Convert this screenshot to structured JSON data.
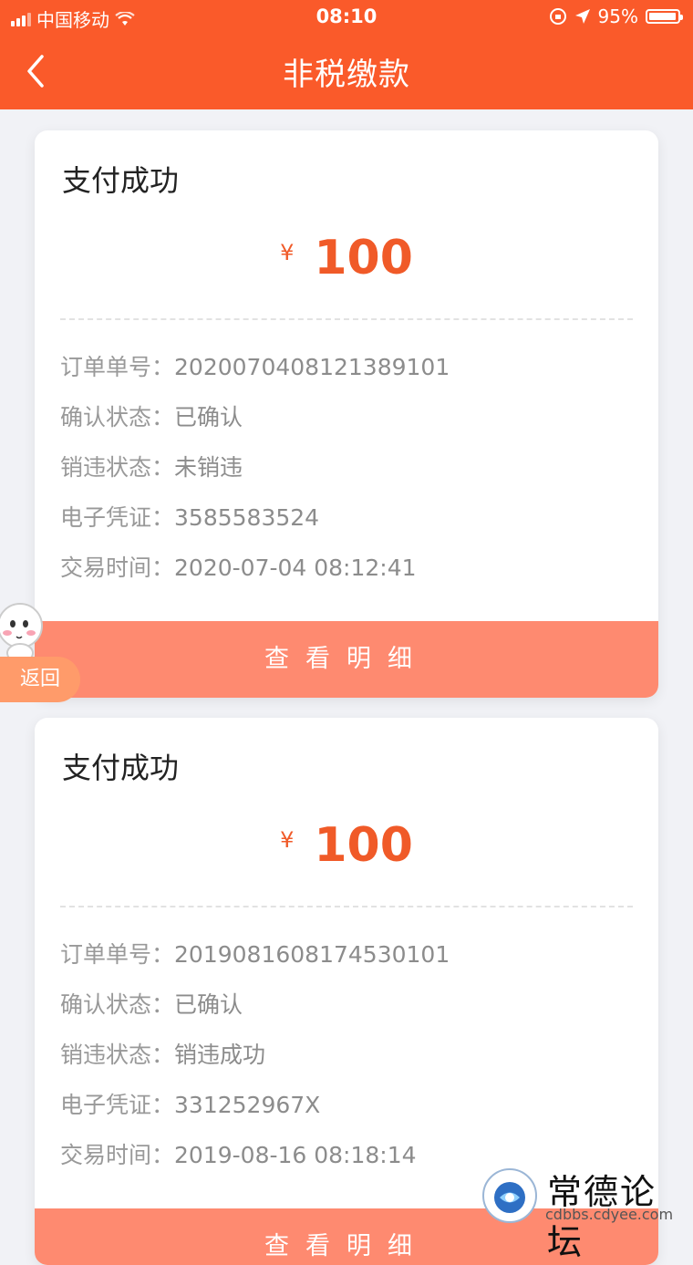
{
  "status_bar": {
    "carrier": "中国移动",
    "time": "08:10",
    "battery": "95%"
  },
  "header": {
    "title": "非税缴款"
  },
  "cards": [
    {
      "status": "支付成功",
      "currency": "¥",
      "amount": "100",
      "fields": [
        {
          "label": "订单单号：",
          "value": "2020070408121389101"
        },
        {
          "label": "确认状态：",
          "value": "已确认"
        },
        {
          "label": "销违状态：",
          "value": "未销违"
        },
        {
          "label": "电子凭证：",
          "value": "3585583524"
        },
        {
          "label": "交易时间：",
          "value": "2020-07-04 08:12:41"
        }
      ],
      "button": "查看明细"
    },
    {
      "status": "支付成功",
      "currency": "¥",
      "amount": "100",
      "fields": [
        {
          "label": "订单单号：",
          "value": "2019081608174530101"
        },
        {
          "label": "确认状态：",
          "value": "已确认"
        },
        {
          "label": "销违状态：",
          "value": "销违成功"
        },
        {
          "label": "电子凭证：",
          "value": "331252967X"
        },
        {
          "label": "交易时间：",
          "value": "2019-08-16 08:18:14"
        }
      ],
      "button": "查看明细"
    }
  ],
  "floating": {
    "back_label": "返回"
  },
  "watermark": {
    "name": "常德论坛",
    "url": "cdbbs.cdyee.com"
  },
  "colors": {
    "brand": "#fa5a2a",
    "amount": "#f05a28",
    "button": "#fe8a70"
  }
}
